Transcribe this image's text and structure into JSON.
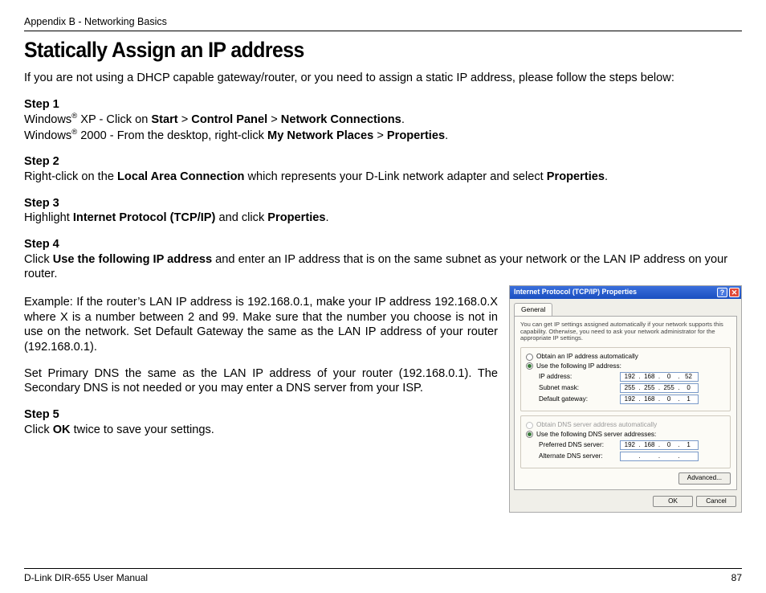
{
  "header": {
    "appendix": "Appendix B - Networking Basics"
  },
  "title": "Statically Assign an IP address",
  "intro": "If you are not using a DHCP capable gateway/router, or you need to assign a static IP address, please follow the steps below:",
  "steps": {
    "s1_label": "Step 1",
    "s1_line1_a": "Windows",
    "s1_line1_b": " XP - Click on ",
    "s1_line1_start": "Start",
    "s1_line1_gt1": " > ",
    "s1_line1_cp": "Control Panel",
    "s1_line1_gt2": " > ",
    "s1_line1_nc": "Network Connections",
    "s1_line1_dot": ".",
    "s1_line2_a": "Windows",
    "s1_line2_b": " 2000 - From the desktop, right-click ",
    "s1_line2_mnp": "My Network Places",
    "s1_line2_gt": " > ",
    "s1_line2_prop": "Properties",
    "s1_line2_dot": ".",
    "s2_label": "Step 2",
    "s2_a": "Right-click on the ",
    "s2_lac": "Local Area Connection",
    "s2_b": " which represents your D-Link network adapter and select ",
    "s2_prop": "Properties",
    "s2_dot": ".",
    "s3_label": "Step 3",
    "s3_a": "Highlight ",
    "s3_ip": "Internet Protocol (TCP/IP)",
    "s3_b": " and click ",
    "s3_prop": "Properties",
    "s3_dot": ".",
    "s4_label": "Step 4",
    "s4_a": "Click ",
    "s4_use": "Use the following IP address",
    "s4_b": " and enter an IP address that is on the same subnet as your network or the LAN IP address on your router.",
    "s4_ex1": "Example: If the router’s LAN IP address is 192.168.0.1, make your IP address 192.168.0.X where X is a number between 2 and 99. Make sure that the number you choose is not in use on the network. Set Default Gateway the same as the LAN IP address of your router (192.168.0.1).",
    "s4_ex2": "Set Primary DNS the same as the LAN IP address of your router (192.168.0.1). The Secondary DNS is not needed or you may enter a DNS server from your ISP.",
    "s5_label": "Step 5",
    "s5_a": "Click ",
    "s5_ok": "OK",
    "s5_b": " twice to save your settings."
  },
  "dialog": {
    "title": "Internet Protocol (TCP/IP) Properties",
    "tab": "General",
    "desc": "You can get IP settings assigned automatically if your network supports this capability. Otherwise, you need to ask your network administrator for the appropriate IP settings.",
    "r_auto_ip": "Obtain an IP address automatically",
    "r_use_ip": "Use the following IP address:",
    "lbl_ip": "IP address:",
    "lbl_mask": "Subnet mask:",
    "lbl_gw": "Default gateway:",
    "ip": [
      "192",
      "168",
      "0",
      "52"
    ],
    "mask": [
      "255",
      "255",
      "255",
      "0"
    ],
    "gw": [
      "192",
      "168",
      "0",
      "1"
    ],
    "r_auto_dns": "Obtain DNS server address automatically",
    "r_use_dns": "Use the following DNS server addresses:",
    "lbl_pdns": "Preferred DNS server:",
    "lbl_adns": "Alternate DNS server:",
    "pdns": [
      "192",
      "168",
      "0",
      "1"
    ],
    "adns": [
      "",
      "",
      "",
      ""
    ],
    "btn_adv": "Advanced...",
    "btn_ok": "OK",
    "btn_cancel": "Cancel"
  },
  "footer": {
    "left": "D-Link DIR-655 User Manual",
    "page": "87"
  },
  "reg": "®"
}
